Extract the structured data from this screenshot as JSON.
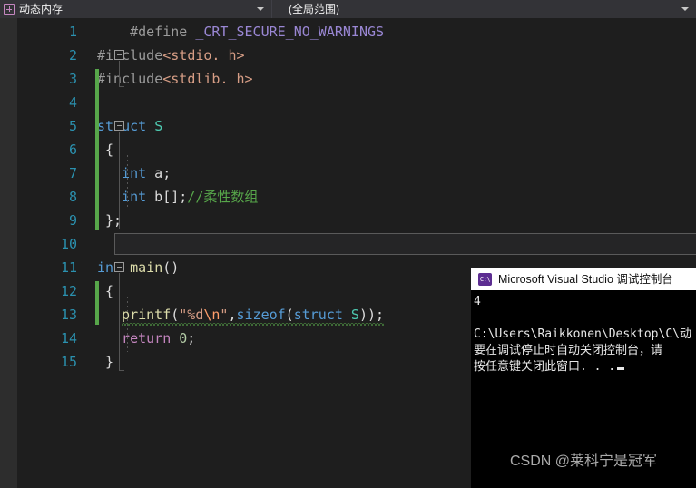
{
  "navbar": {
    "scope_combo": {
      "icon": "expand-box-icon",
      "label": "动态内存",
      "arrow": "chevron-down-icon"
    },
    "member_combo": {
      "label": "(全局范围)",
      "arrow": "chevron-down-icon"
    }
  },
  "editor": {
    "language": "c",
    "current_line": 10,
    "lines": [
      {
        "num": "1",
        "indent": 4,
        "fold": false,
        "changed": false,
        "tokens": [
          {
            "t": "#define ",
            "c": "c-pre"
          },
          {
            "t": "_CRT_SECURE_NO_WARNINGS",
            "c": "c-macro"
          }
        ]
      },
      {
        "num": "2",
        "indent": 0,
        "fold": true,
        "changed": false,
        "tokens": [
          {
            "t": "#include",
            "c": "c-pre"
          },
          {
            "t": "<stdio. h>",
            "c": "c-inc"
          }
        ]
      },
      {
        "num": "3",
        "indent": 0,
        "fold": false,
        "changed": true,
        "tokens": [
          {
            "t": "#include",
            "c": "c-pre"
          },
          {
            "t": "<stdlib. h>",
            "c": "c-inc"
          }
        ]
      },
      {
        "num": "4",
        "indent": 0,
        "fold": false,
        "changed": true,
        "tokens": []
      },
      {
        "num": "5",
        "indent": 0,
        "fold": true,
        "changed": true,
        "tokens": [
          {
            "t": "struct",
            "c": "c-kw"
          },
          {
            "t": " ",
            "c": "c-punct"
          },
          {
            "t": "S",
            "c": "c-type"
          }
        ]
      },
      {
        "num": "6",
        "indent": 1,
        "fold": false,
        "changed": true,
        "tokens": [
          {
            "t": "{",
            "c": "c-punct"
          }
        ]
      },
      {
        "num": "7",
        "indent": 3,
        "fold": false,
        "changed": true,
        "tokens": [
          {
            "t": "int",
            "c": "c-kw"
          },
          {
            "t": " a;",
            "c": "c-punct"
          }
        ]
      },
      {
        "num": "8",
        "indent": 3,
        "fold": false,
        "changed": true,
        "tokens": [
          {
            "t": "int",
            "c": "c-kw"
          },
          {
            "t": " b[];",
            "c": "c-punct"
          },
          {
            "t": "//柔性数组",
            "c": "c-com"
          }
        ]
      },
      {
        "num": "9",
        "indent": 1,
        "fold": false,
        "changed": true,
        "tokens": [
          {
            "t": "};",
            "c": "c-punct"
          }
        ]
      },
      {
        "num": "10",
        "indent": 1,
        "fold": false,
        "changed": false,
        "tokens": []
      },
      {
        "num": "11",
        "indent": 0,
        "fold": true,
        "changed": false,
        "tokens": [
          {
            "t": "int",
            "c": "c-kw"
          },
          {
            "t": " ",
            "c": "c-punct"
          },
          {
            "t": "main",
            "c": "c-fn"
          },
          {
            "t": "()",
            "c": "c-punct"
          }
        ]
      },
      {
        "num": "12",
        "indent": 1,
        "fold": false,
        "changed": true,
        "tokens": [
          {
            "t": "{",
            "c": "c-punct"
          }
        ]
      },
      {
        "num": "13",
        "indent": 3,
        "fold": false,
        "changed": true,
        "squiggle": true,
        "tokens": [
          {
            "t": "printf",
            "c": "c-fn"
          },
          {
            "t": "(",
            "c": "c-punct"
          },
          {
            "t": "\"%d",
            "c": "c-str"
          },
          {
            "t": "\\n",
            "c": "c-esc"
          },
          {
            "t": "\"",
            "c": "c-str"
          },
          {
            "t": ",",
            "c": "c-punct"
          },
          {
            "t": "sizeof",
            "c": "c-kw"
          },
          {
            "t": "(",
            "c": "c-punct"
          },
          {
            "t": "struct",
            "c": "c-kw"
          },
          {
            "t": " ",
            "c": "c-punct"
          },
          {
            "t": "S",
            "c": "c-type"
          },
          {
            "t": "));",
            "c": "c-punct"
          }
        ]
      },
      {
        "num": "14",
        "indent": 3,
        "fold": false,
        "changed": false,
        "tokens": [
          {
            "t": "return",
            "c": "c-ctl"
          },
          {
            "t": " ",
            "c": "c-punct"
          },
          {
            "t": "0",
            "c": "c-num"
          },
          {
            "t": ";",
            "c": "c-punct"
          }
        ]
      },
      {
        "num": "15",
        "indent": 1,
        "fold": false,
        "changed": false,
        "tokens": [
          {
            "t": "}",
            "c": "c-punct"
          }
        ]
      }
    ]
  },
  "console": {
    "icon": "visual-studio-console-icon",
    "title": "Microsoft Visual Studio 调试控制台",
    "output": [
      "4",
      "",
      "C:\\Users\\Raikkonen\\Desktop\\C\\动",
      "要在调试停止时自动关闭控制台，请",
      "按任意键关闭此窗口. . ."
    ]
  },
  "watermark": {
    "text": "CSDN @莱科宁是冠军"
  },
  "colors": {
    "editor_background": "#1e1e1e",
    "navbar_background": "#2d2d30",
    "line_number": "#2b91af",
    "change_bar": "#57a64a",
    "comment": "#57a64a",
    "keyword": "#569cd6",
    "type": "#4ec9b0",
    "string": "#d69d85",
    "function": "#dcdcaa",
    "console_background": "#000000"
  }
}
